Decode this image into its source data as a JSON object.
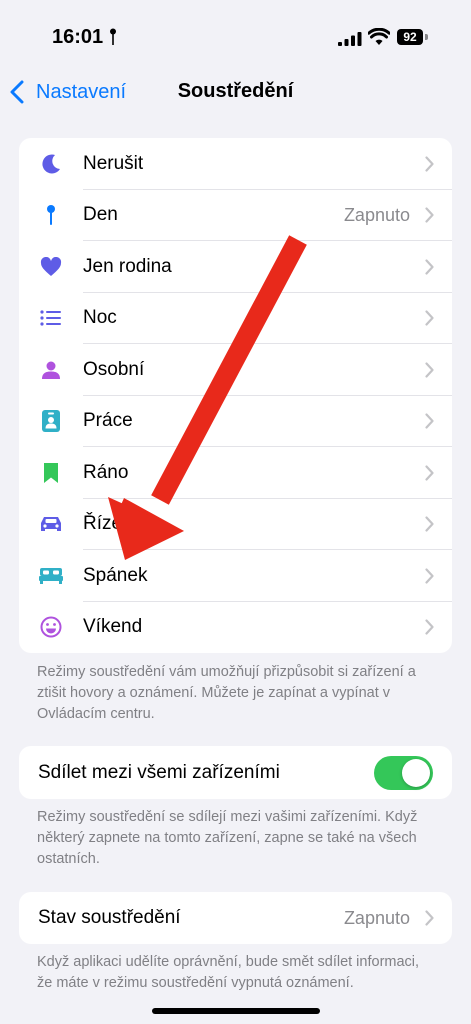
{
  "status": {
    "time": "16:01",
    "battery": "92"
  },
  "nav": {
    "back_label": "Nastavení",
    "title": "Soustředění"
  },
  "focus_modes": [
    {
      "label": "Nerušit",
      "value": "",
      "icon": "moon-icon",
      "color": "#5e5ce6"
    },
    {
      "label": "Den",
      "value": "Zapnuto",
      "icon": "pin-icon",
      "color": "#0a7aff"
    },
    {
      "label": "Jen rodina",
      "value": "",
      "icon": "heart-icon",
      "color": "#5e5ce6"
    },
    {
      "label": "Noc",
      "value": "",
      "icon": "list-icon",
      "color": "#5e5ce6"
    },
    {
      "label": "Osobní",
      "value": "",
      "icon": "person-icon",
      "color": "#af52de"
    },
    {
      "label": "Práce",
      "value": "",
      "icon": "badge-icon",
      "color": "#30b0c7"
    },
    {
      "label": "Ráno",
      "value": "",
      "icon": "bookmark-icon",
      "color": "#34c759"
    },
    {
      "label": "Řízení",
      "value": "",
      "icon": "car-icon",
      "color": "#5e5ce6"
    },
    {
      "label": "Spánek",
      "value": "",
      "icon": "bed-icon",
      "color": "#30b0c7"
    },
    {
      "label": "Víkend",
      "value": "",
      "icon": "smiley-icon",
      "color": "#af52de"
    }
  ],
  "modes_footer": "Režimy soustředění vám umožňují přizpůsobit si zařízení a ztišit hovory a oznámení. Můžete je zapínat a vypínat v Ovládacím centru.",
  "share": {
    "label": "Sdílet mezi všemi zařízeními",
    "enabled": true,
    "footer": "Režimy soustředění se sdílejí mezi vašimi zařízeními. Když některý zapnete na tomto zařízení, zapne se také na všech ostatních."
  },
  "focus_status": {
    "label": "Stav soustředění",
    "value": "Zapnuto",
    "footer": "Když aplikaci udělíte oprávnění, bude smět sdílet informaci, že máte v režimu soustředění vypnutá oznámení."
  },
  "colors": {
    "accent": "#0a7aff",
    "toggle_on": "#34c759",
    "annotation_arrow": "#e8291b"
  }
}
